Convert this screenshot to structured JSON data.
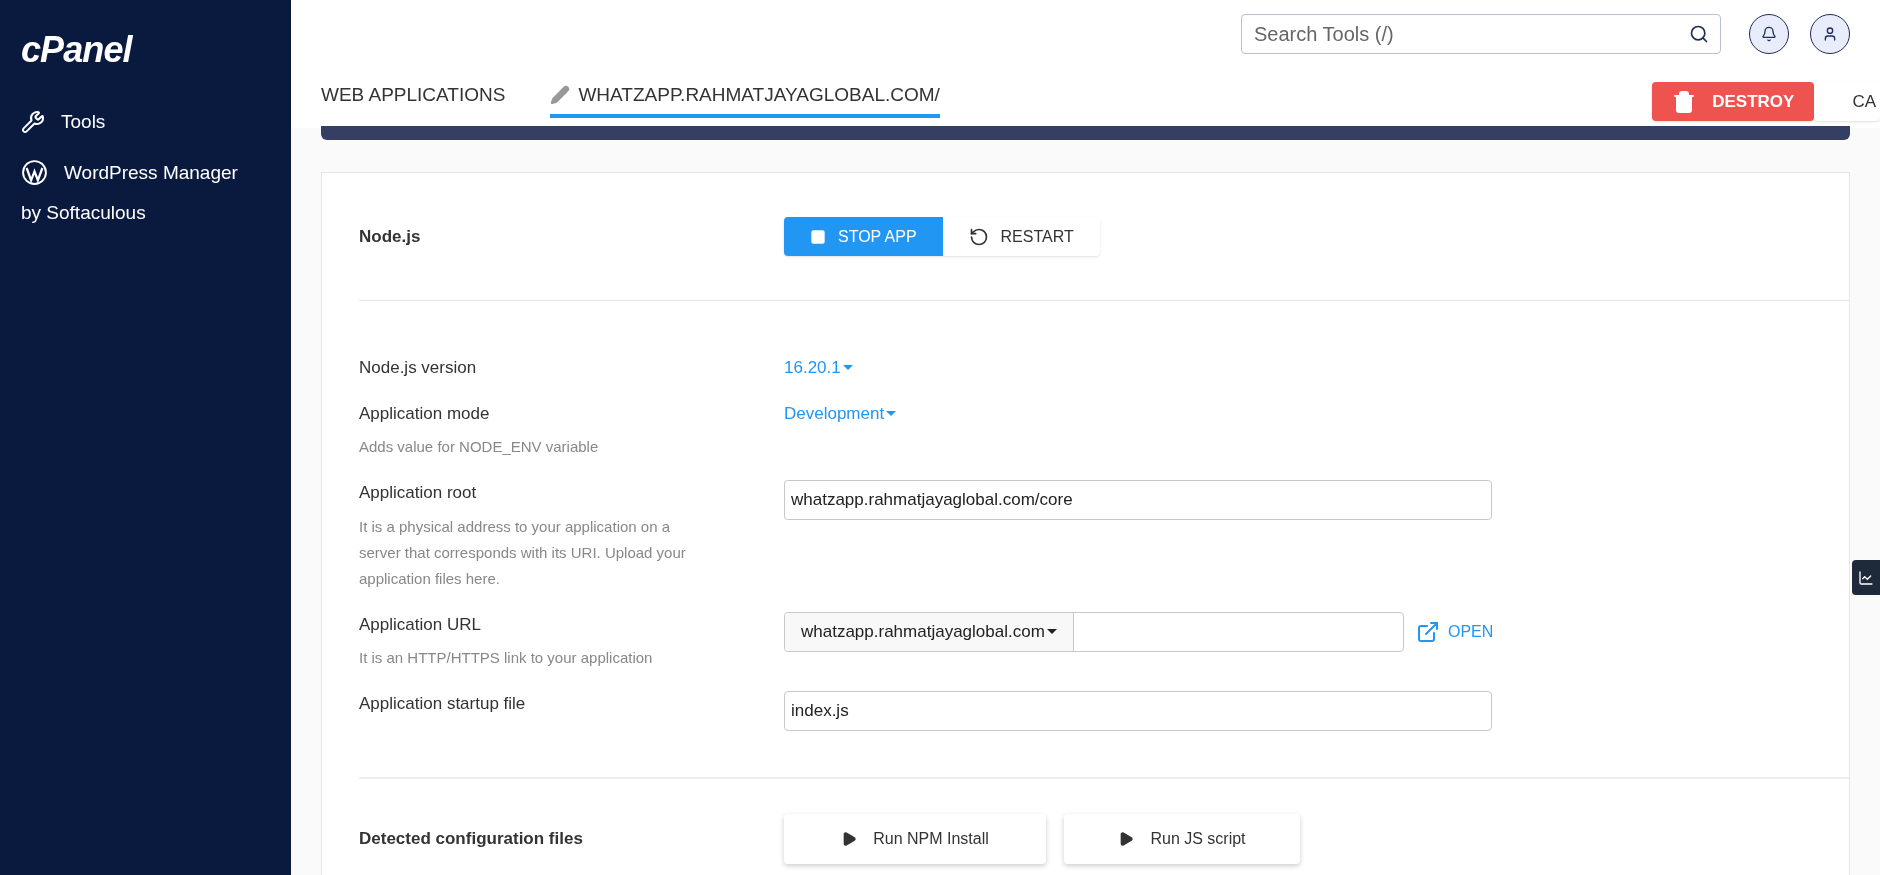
{
  "sidebar": {
    "logo": "cPanel",
    "items": [
      {
        "label": "Tools",
        "kind": "tools"
      },
      {
        "label": "WordPress Manager",
        "kind": "wordpress",
        "sub": "by Softaculous"
      }
    ]
  },
  "header": {
    "search": {
      "placeholder": "Search Tools (/)"
    }
  },
  "tabs": [
    {
      "label": "WEB APPLICATIONS",
      "selected": false,
      "editable": false
    },
    {
      "label": "WHATZAPP.RAHMATJAYAGLOBAL.COM/",
      "selected": true,
      "editable": true
    }
  ],
  "actions": [
    {
      "label": "DESTROY",
      "kind": "danger"
    },
    {
      "label": "CA",
      "kind": "plain"
    }
  ],
  "app_section": {
    "title": "Node.js",
    "buttons": [
      {
        "label": "STOP APP",
        "kind": "stop",
        "selected": true
      },
      {
        "label": "RESTART",
        "kind": "restart",
        "selected": false
      }
    ]
  },
  "fields": [
    {
      "kind": "dropdown",
      "label": "Node.js version",
      "value": "16.20.1"
    },
    {
      "kind": "dropdown",
      "label": "Application mode",
      "value": "Development",
      "hint": "Adds value for NODE_ENV variable"
    },
    {
      "kind": "text",
      "label": "Application root",
      "value": "whatzapp.rahmatjayaglobal.com/core",
      "hint": "It is a physical address to your application on a server that corresponds with its URI. Upload your application files here."
    },
    {
      "kind": "url",
      "label": "Application URL",
      "domain": "whatzapp.rahmatjayaglobal.com",
      "link": "OPEN",
      "hint": "It is an HTTP/HTTPS link to your application"
    },
    {
      "kind": "text",
      "label": "Application startup file",
      "value": "index.js"
    }
  ],
  "config_section": {
    "title": "Detected configuration files",
    "buttons": [
      "Run NPM Install",
      "Run JS script"
    ]
  }
}
